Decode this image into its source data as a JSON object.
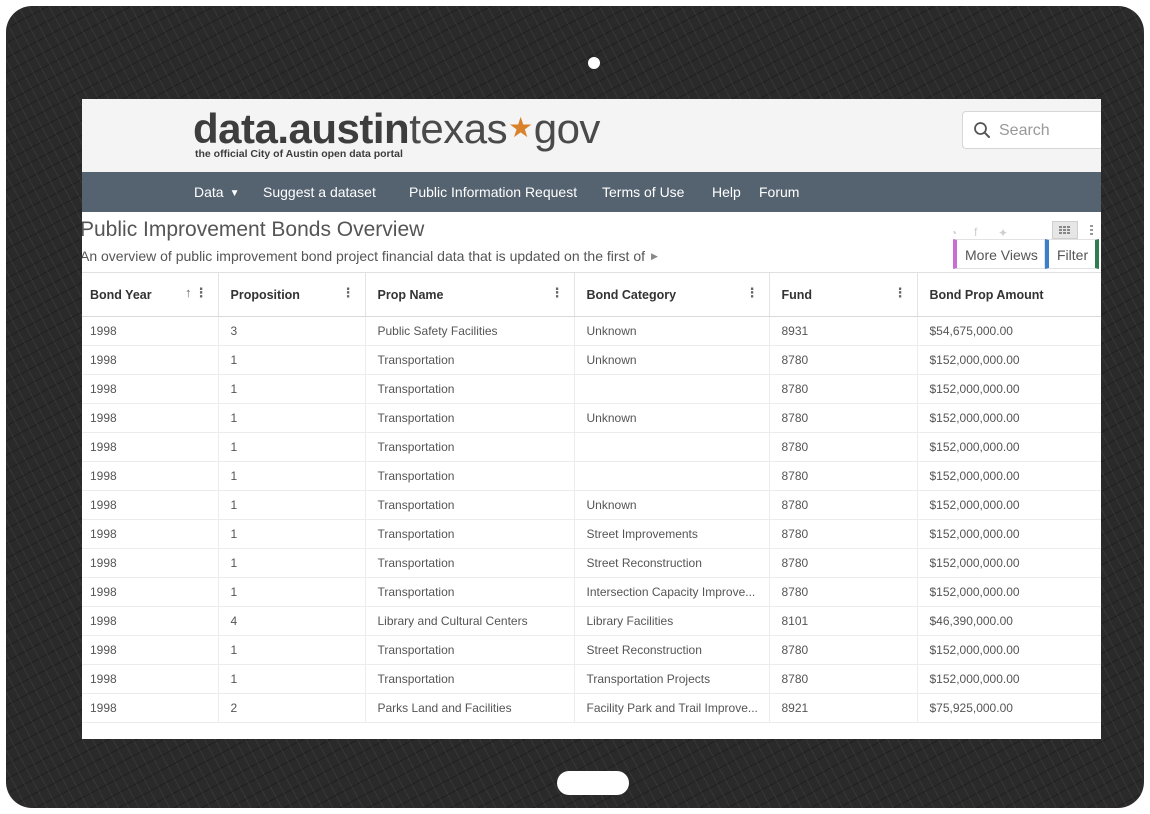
{
  "colors": {
    "nav_bg": "#556270",
    "accent_star": "#d9822b",
    "more_views_border": "#c96fd2",
    "filter_border": "#3d7ecb"
  },
  "header": {
    "logo_bold": "data.austin",
    "logo_light_1": "texas",
    "logo_light_2": "gov",
    "tagline": "the official City of Austin open data portal",
    "search_placeholder": "Search"
  },
  "nav": {
    "items": [
      {
        "label": "Data"
      },
      {
        "label": "Suggest a dataset"
      },
      {
        "label": "Public Information Request"
      },
      {
        "label": "Terms of Use"
      },
      {
        "label": "Help"
      },
      {
        "label": "Forum"
      }
    ]
  },
  "dataset": {
    "title": "Public Improvement Bonds Overview",
    "description": "An overview of public improvement bond project financial data that is updated on the first of",
    "buttons": {
      "more_views": "More Views",
      "filter": "Filter"
    }
  },
  "table": {
    "columns": [
      "Bond Year",
      "Proposition",
      "Prop Name",
      "Bond Category",
      "Fund",
      "Bond Prop Amount"
    ],
    "rows": [
      [
        "1998",
        "3",
        "Public Safety Facilities",
        "Unknown",
        "8931",
        "$54,675,000.00"
      ],
      [
        "1998",
        "1",
        "Transportation",
        "Unknown",
        "8780",
        "$152,000,000.00"
      ],
      [
        "1998",
        "1",
        "Transportation",
        "",
        "8780",
        "$152,000,000.00"
      ],
      [
        "1998",
        "1",
        "Transportation",
        "Unknown",
        "8780",
        "$152,000,000.00"
      ],
      [
        "1998",
        "1",
        "Transportation",
        "",
        "8780",
        "$152,000,000.00"
      ],
      [
        "1998",
        "1",
        "Transportation",
        "",
        "8780",
        "$152,000,000.00"
      ],
      [
        "1998",
        "1",
        "Transportation",
        "Unknown",
        "8780",
        "$152,000,000.00"
      ],
      [
        "1998",
        "1",
        "Transportation",
        "Street Improvements",
        "8780",
        "$152,000,000.00"
      ],
      [
        "1998",
        "1",
        "Transportation",
        "Street Reconstruction",
        "8780",
        "$152,000,000.00"
      ],
      [
        "1998",
        "1",
        "Transportation",
        "Intersection Capacity Improve...",
        "8780",
        "$152,000,000.00"
      ],
      [
        "1998",
        "4",
        "Library and Cultural Centers",
        "Library Facilities",
        "8101",
        "$46,390,000.00"
      ],
      [
        "1998",
        "1",
        "Transportation",
        "Street Reconstruction",
        "8780",
        "$152,000,000.00"
      ],
      [
        "1998",
        "1",
        "Transportation",
        "Transportation Projects",
        "8780",
        "$152,000,000.00"
      ],
      [
        "1998",
        "2",
        "Parks Land and Facilities",
        "Facility Park and Trail Improve...",
        "8921",
        "$75,925,000.00"
      ]
    ]
  }
}
